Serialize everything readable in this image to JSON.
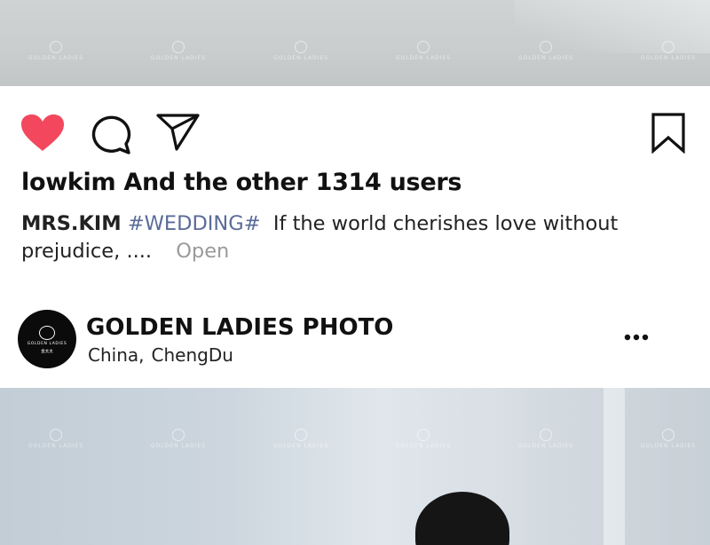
{
  "watermark": {
    "brand": "GOLDEN LADIES",
    "sub": "金太太"
  },
  "actions": {
    "like_icon": "heart-filled-icon",
    "comment_icon": "comment-bubble-icon",
    "share_icon": "paper-plane-icon",
    "save_icon": "bookmark-icon",
    "like_color": "#f2475d"
  },
  "likes": {
    "text": "lowkim And the other 1314 users"
  },
  "caption": {
    "author": "MRS.KIM",
    "hashtag": "#WEDDING#",
    "text": "If the world cherishes love without prejudice, ....",
    "open_label": "Open"
  },
  "account": {
    "avatar_brand": "GOLDEN LADIES",
    "avatar_sub": "金太太",
    "name": "GOLDEN LADIES PHOTO",
    "location_country": "China,",
    "location_city": "ChengDu",
    "more_icon": "more-dots-icon"
  }
}
